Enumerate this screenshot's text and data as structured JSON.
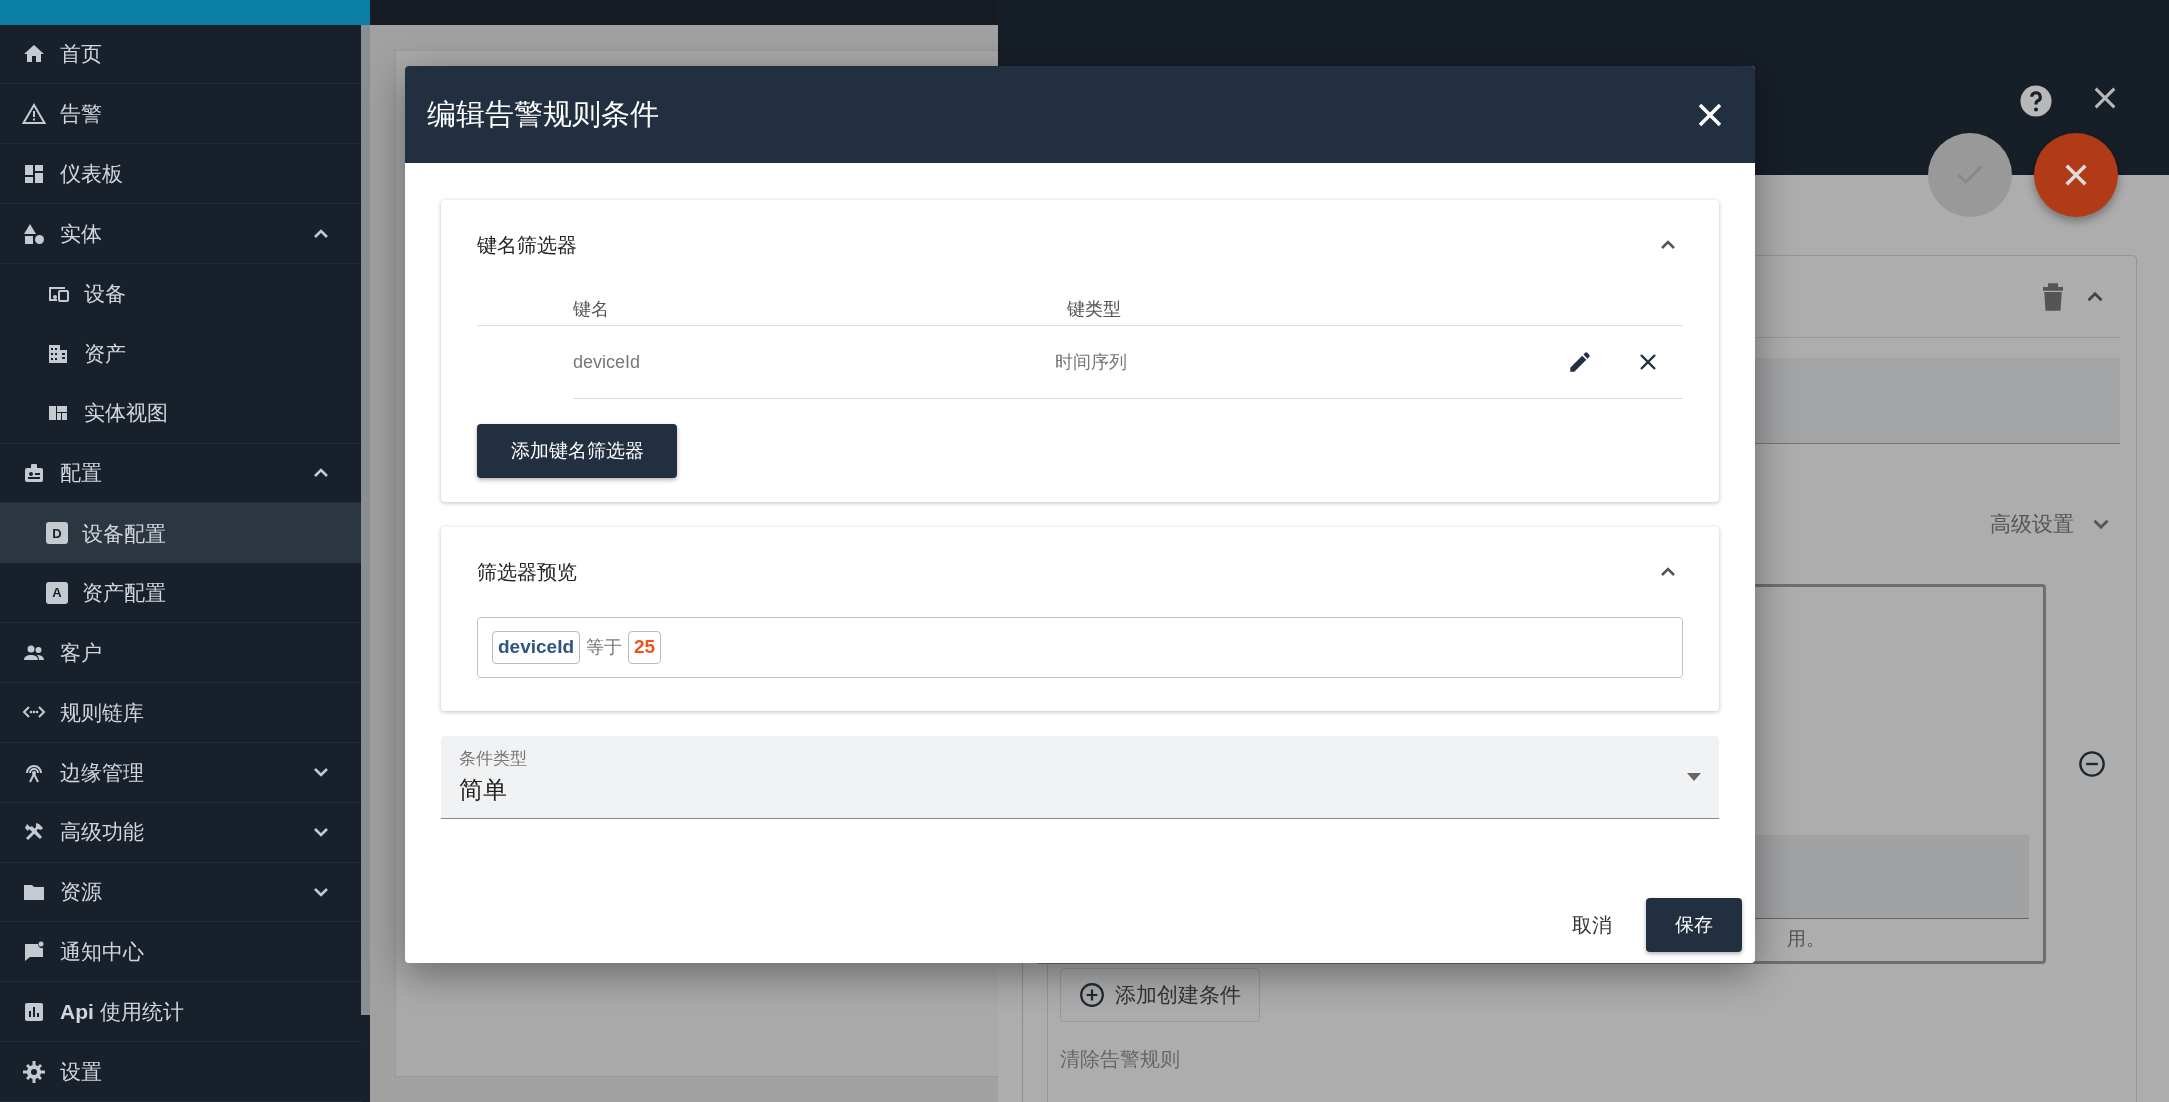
{
  "sidebar": {
    "items": [
      {
        "label": "首页",
        "selected": false
      },
      {
        "label": "告警",
        "selected": false
      },
      {
        "label": "仪表板",
        "selected": false
      },
      {
        "label": "实体",
        "selected": false,
        "expanded": true,
        "children": [
          {
            "label": "设备",
            "selected": false
          },
          {
            "label": "资产",
            "selected": false
          },
          {
            "label": "实体视图",
            "selected": false
          }
        ]
      },
      {
        "label": "配置",
        "selected": false,
        "expanded": true,
        "children": [
          {
            "label": "设备配置",
            "badge": "D",
            "selected": true
          },
          {
            "label": "资产配置",
            "badge": "A",
            "selected": false
          }
        ]
      },
      {
        "label": "客户",
        "selected": false
      },
      {
        "label": "规则链库",
        "selected": false
      },
      {
        "label": "边缘管理",
        "selected": false,
        "expanded": false
      },
      {
        "label": "高级功能",
        "selected": false,
        "expanded": false
      },
      {
        "label": "资源",
        "selected": false,
        "expanded": false
      },
      {
        "label": "通知中心",
        "selected": false
      },
      {
        "label": "**Api** 使用统计",
        "selected": false
      },
      {
        "label": "设置",
        "selected": false
      }
    ]
  },
  "details_panel": {
    "advanced_settings": {
      "label": "高级设置",
      "expanded": false
    },
    "note_fragment": "用。",
    "add_condition_button": "添加创建条件",
    "clear_rule_label": "清除告警规则"
  },
  "dialog": {
    "title": "编辑告警规则条件",
    "key_filters": {
      "title": "键名筛选器",
      "expanded": true,
      "columns": [
        "键名",
        "键类型"
      ],
      "rows": [
        {
          "key": "deviceId",
          "type": "时间序列"
        }
      ],
      "add_button": "添加键名筛选器"
    },
    "preview": {
      "title": "筛选器预览",
      "expanded": true,
      "chips": [
        {
          "kind": "key",
          "text": "deviceId"
        },
        {
          "kind": "operator",
          "text": "等于"
        },
        {
          "kind": "value",
          "text": "25"
        }
      ]
    },
    "condition_type": {
      "label": "条件类型",
      "value": "简单"
    },
    "cancel_button": "取消",
    "save_button": "保存"
  }
}
